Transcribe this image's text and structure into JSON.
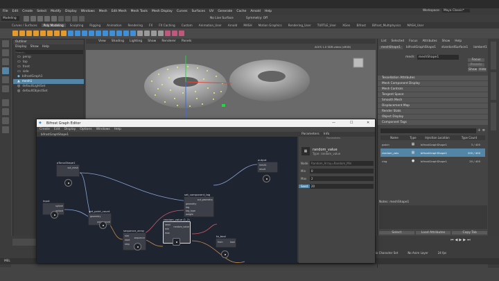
{
  "menubar": {
    "items": [
      "File",
      "Edit",
      "Create",
      "Select",
      "Modify",
      "Display",
      "Windows",
      "Mesh",
      "Edit Mesh",
      "Mesh Tools",
      "Mesh Display",
      "Curves",
      "Surfaces",
      "UV",
      "Generate",
      "Cache",
      "Arnold",
      "Help"
    ]
  },
  "status": {
    "mode": "Modeling",
    "workspace_label": "Workspace:",
    "workspace_value": "Maya Classic*",
    "live_surface": "No Live Surface",
    "symmetry": "Symmetry: Off"
  },
  "shelf_tabs": [
    "Curves / Surfaces",
    "Poly Modeling",
    "Sculpting",
    "Rigging",
    "Animation",
    "Rendering",
    "FX",
    "FX Caching",
    "Custom",
    "Animation_User",
    "Arnold",
    "MASH",
    "Motion Graphics",
    "Rendering_User",
    "TURTLE_User",
    "XGen",
    "Bifrost",
    "Bifrost_Multiphysics",
    "MASH_User"
  ],
  "shelf_active": "Poly Modeling",
  "outliner": {
    "title": "Outliner",
    "menu": [
      "Display",
      "Show",
      "Help"
    ],
    "search_placeholder": "Search...",
    "items": [
      "persp",
      "top",
      "front",
      "side",
      "bifrostGraph1",
      "mesh1",
      "defaultLightSet",
      "defaultObjectSet"
    ],
    "selected": "bifrostGraph1"
  },
  "viewport": {
    "menu": [
      "View",
      "Shading",
      "Lighting",
      "Show",
      "Renderer",
      "Panels"
    ],
    "colorspace": "ACES 1.0 SDR-video (sRGB)"
  },
  "graph_editor": {
    "title": "Bifrost Graph Editor",
    "menu": [
      "Create",
      "Edit",
      "Display",
      "Options",
      "Windows",
      "Help"
    ],
    "path": "bifrostGraphShape1",
    "tab": "bifrostGraphShape1",
    "nodes": {
      "input": {
        "title": "input",
        "pins": [
          "sphere",
          "output"
        ]
      },
      "torus": {
        "title": "pTorusShape1",
        "pins": [
          "out_mesh"
        ]
      },
      "get_point": {
        "title": "get_point_count",
        "pins": [
          "geometry",
          "point_count"
        ]
      },
      "sequence": {
        "title": "sequence_array",
        "pins": [
          "size",
          "start",
          "step",
          "sequence"
        ]
      },
      "random": {
        "title": "random_value (1_2)",
        "pins": [
          "seed",
          "min",
          "max",
          "random_value"
        ]
      },
      "set_comp": {
        "title": "set_component_tag",
        "pins": [
          "out_geometry",
          "geometry",
          "tag",
          "tag_type",
          "weight"
        ]
      },
      "output": {
        "title": "output",
        "pins": [
          "mesh1",
          "result"
        ]
      },
      "to_bool": {
        "title": "to_bool",
        "pins": [
          "from",
          "bool"
        ]
      }
    },
    "params": {
      "tabs": [
        "Parameters",
        "Info"
      ],
      "header": "Parameters",
      "node_name": "random_value",
      "node_type": "Type: random_value",
      "rows": [
        {
          "label": "Node",
          "value": "Random_Array=Random_Min"
        },
        {
          "label": "Min",
          "value": "0"
        },
        {
          "label": "Max",
          "value": "2"
        },
        {
          "label": "Seed",
          "value": "20"
        }
      ]
    },
    "window_controls": [
      "—",
      "☐",
      "✕"
    ]
  },
  "attribute_editor": {
    "menu": [
      "List",
      "Selected",
      "Focus",
      "Attributes",
      "Show",
      "Help"
    ],
    "tabs": [
      "meshShape1",
      "bifrostGraphShape1",
      "standardSurface1",
      "lambert1"
    ],
    "field_label": "mesh:",
    "field_value": "meshShape1",
    "focus": "Focus",
    "presets": "Presets",
    "show": "Show",
    "hide": "Hide",
    "sections": [
      "Tessellation Attributes",
      "Mesh Component Display",
      "Mesh Controls",
      "Tangent Space",
      "Smooth Mesh",
      "Displacement Map",
      "Render Stats",
      "Object Display",
      "Component Tags"
    ],
    "tags_table": {
      "columns": [
        "Name",
        "Type",
        "Injection Location",
        "Type Count"
      ],
      "rows": [
        {
          "name": "patch",
          "location": "bifrostGraphShape1",
          "count": "3 / 400"
        },
        {
          "name": "random_vals",
          "location": "bifrostGraphShape1",
          "count": "200 / 400"
        },
        {
          "name": "ring",
          "location": "bifrostGraphShape1",
          "count": "20 / 400"
        }
      ],
      "selected": "random_vals"
    },
    "notes_label": "Notes: meshShape1",
    "buttons": [
      "Select",
      "Load Attributes",
      "Copy Tab"
    ]
  },
  "timeline": {
    "fps": "24 fps",
    "anim_layer": "No Anim Layer",
    "char_set": "No Character Set",
    "cmd_label": "MEL"
  },
  "colors": {
    "accent": "#5285a6",
    "canvas": "#1f2530",
    "node": "#464a53"
  }
}
